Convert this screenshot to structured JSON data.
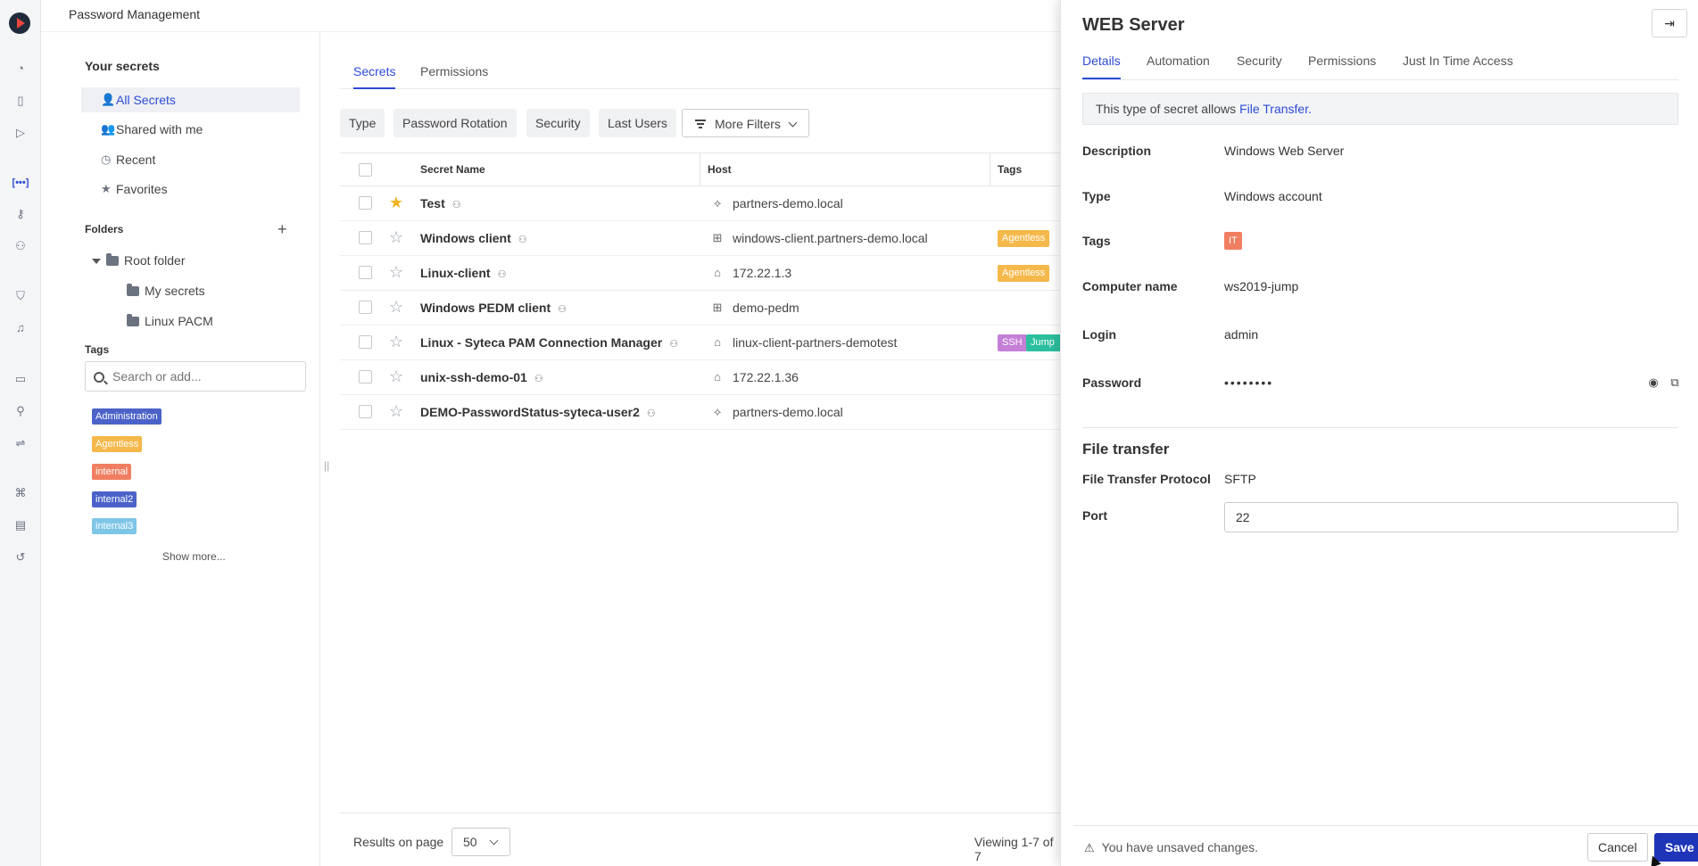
{
  "app": {
    "title": "Password Management"
  },
  "rail": {
    "icons": [
      "dashboard-icon",
      "document-icon",
      "play-icon",
      "password-icon",
      "key-icon",
      "users-key-icon",
      "shield-icon",
      "bell-icon",
      "monitor-icon",
      "user-icon",
      "usb-icon",
      "hierarchy-icon",
      "chart-icon",
      "history-icon"
    ],
    "active_glyph": "[•••]"
  },
  "sidebar": {
    "heading": "Your secrets",
    "items": [
      {
        "label": "All Secrets",
        "icon": "person-icon",
        "active": true
      },
      {
        "label": "Shared with me",
        "icon": "people-icon"
      },
      {
        "label": "Recent",
        "icon": "clock-icon"
      },
      {
        "label": "Favorites",
        "icon": "star-icon"
      }
    ],
    "folders_label": "Folders",
    "folders": [
      {
        "label": "Root folder"
      },
      {
        "label": "My secrets"
      },
      {
        "label": "Linux PACM"
      }
    ],
    "tags_label": "Tags",
    "tag_search_placeholder": "Search or add...",
    "tags": [
      {
        "label": "Administration",
        "color": "#4b63c9"
      },
      {
        "label": "Agentless",
        "color": "#f5b84a"
      },
      {
        "label": "internal",
        "color": "#f07f62"
      },
      {
        "label": "internal2",
        "color": "#4b63c9"
      },
      {
        "label": "internal3",
        "color": "#7ec6e8"
      }
    ],
    "show_more": "Show more..."
  },
  "main": {
    "tabs": [
      {
        "label": "Secrets",
        "active": true
      },
      {
        "label": "Permissions"
      }
    ],
    "filters": [
      "Type",
      "Password Rotation",
      "Security",
      "Last Users"
    ],
    "more_filters": "More Filters",
    "columns": [
      "Secret Name",
      "Host",
      "Tags"
    ],
    "rows": [
      {
        "name": "Test",
        "fav": true,
        "host_icon": "network-icon",
        "host": "partners-demo.local",
        "tags": []
      },
      {
        "name": "Windows client",
        "fav": false,
        "host_icon": "windows-icon",
        "host": "windows-client.partners-demo.local",
        "tags": [
          {
            "label": "Agentless",
            "color": "#f5b84a"
          }
        ]
      },
      {
        "name": "Linux-client",
        "fav": false,
        "host_icon": "linux-icon",
        "host": "172.22.1.3",
        "tags": [
          {
            "label": "Agentless",
            "color": "#f5b84a"
          }
        ]
      },
      {
        "name": "Windows PEDM client",
        "fav": false,
        "host_icon": "windows-icon",
        "host": "demo-pedm",
        "tags": []
      },
      {
        "name": "Linux - Syteca PAM Connection Manager",
        "fav": false,
        "host_icon": "linux-icon",
        "host": "linux-client-partners-demotest",
        "tags": [
          {
            "label": "SSH",
            "color": "#c47fd6"
          },
          {
            "label": "Jump",
            "color": "#2bbf9e"
          }
        ]
      },
      {
        "name": "unix-ssh-demo-01",
        "fav": false,
        "host_icon": "linux-icon",
        "host": "172.22.1.36",
        "tags": []
      },
      {
        "name": "DEMO-PasswordStatus-syteca-user2",
        "fav": false,
        "host_icon": "network-icon",
        "host": "partners-demo.local",
        "tags": []
      }
    ],
    "results_label": "Results on page",
    "results_value": "50",
    "viewing": "Viewing 1-7 of 7"
  },
  "panel": {
    "title": "WEB Server",
    "tabs": [
      {
        "label": "Details",
        "active": true
      },
      {
        "label": "Automation"
      },
      {
        "label": "Security"
      },
      {
        "label": "Permissions"
      },
      {
        "label": "Just In Time Access"
      }
    ],
    "info_prefix": "This type of secret allows ",
    "info_link": "File Transfer.",
    "fields": {
      "description_label": "Description",
      "description_value": "Windows Web Server",
      "type_label": "Type",
      "type_value": "Windows account",
      "tags_label": "Tags",
      "tag_value": "IT",
      "computer_label": "Computer name",
      "computer_value": "ws2019-jump",
      "login_label": "Login",
      "login_value": "admin",
      "password_label": "Password",
      "password_value": "••••••••"
    },
    "file_transfer": {
      "heading": "File transfer",
      "protocol_label": "File Transfer Protocol",
      "protocol_value": "SFTP",
      "port_label": "Port",
      "port_value": "22"
    },
    "unsaved": "You have unsaved changes.",
    "cancel_label": "Cancel",
    "save_label": "Save"
  }
}
